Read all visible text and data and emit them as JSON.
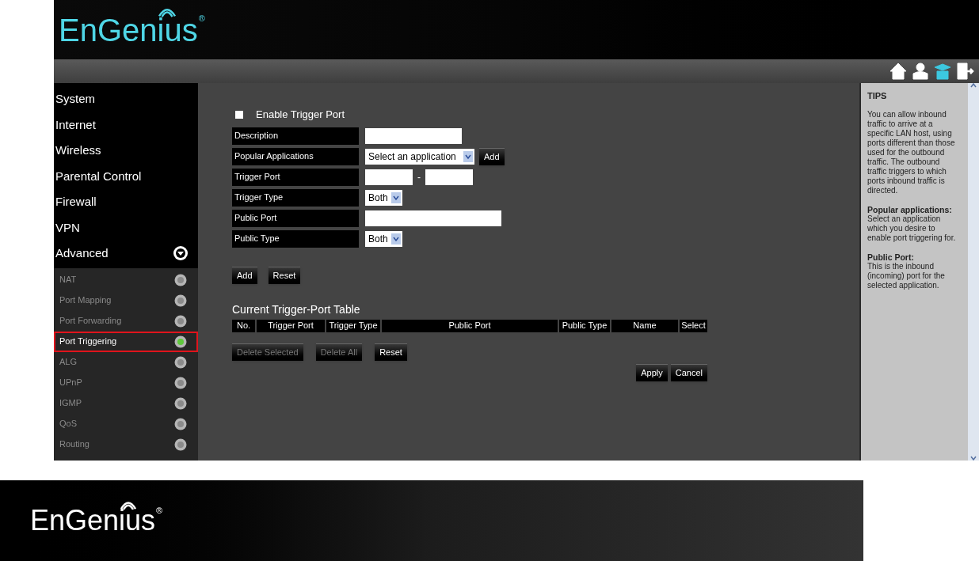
{
  "header": {
    "logo": "EnGenius",
    "logo_mark": "®",
    "icons": [
      {
        "kind": "home",
        "selected": false
      },
      {
        "kind": "user",
        "selected": false
      },
      {
        "kind": "wizard",
        "selected": true
      },
      {
        "kind": "exit",
        "selected": false
      }
    ]
  },
  "sidebar": {
    "items": [
      {
        "label": "System"
      },
      {
        "label": "Internet"
      },
      {
        "label": "Wireless"
      },
      {
        "label": "Parental Control"
      },
      {
        "label": "Firewall"
      },
      {
        "label": "VPN"
      },
      {
        "label": "Advanced",
        "expanded": true,
        "children": [
          {
            "label": "NAT",
            "selected": false
          },
          {
            "label": "Port Mapping",
            "selected": false
          },
          {
            "label": "Port Forwarding",
            "selected": false
          },
          {
            "label": "Port Triggering",
            "selected": true
          },
          {
            "label": "ALG",
            "selected": false
          },
          {
            "label": "UPnP",
            "selected": false
          },
          {
            "label": "IGMP",
            "selected": false
          },
          {
            "label": "QoS",
            "selected": false
          },
          {
            "label": "Routing",
            "selected": false
          }
        ]
      }
    ]
  },
  "form": {
    "enable": {
      "label": "Enable Trigger Port",
      "checked": false
    },
    "rows": [
      {
        "label": "Description",
        "kind": "text"
      },
      {
        "label": "Popular Applications",
        "kind": "select_add",
        "value": "Select an application",
        "button": "Add"
      },
      {
        "label": "Trigger Port",
        "kind": "range",
        "separator": "-"
      },
      {
        "label": "Trigger Type",
        "kind": "select",
        "value": "Both"
      },
      {
        "label": "Public Port",
        "kind": "wide_text"
      },
      {
        "label": "Public Type",
        "kind": "select",
        "value": "Both"
      }
    ],
    "buttons": [
      "Add",
      "Reset"
    ]
  },
  "table": {
    "title": "Current Trigger-Port Table",
    "columns": [
      "No.",
      "Trigger Port",
      "Trigger Type",
      "Public Port",
      "Public Type",
      "Name",
      "Select"
    ],
    "buttons": [
      {
        "label": "Delete Selected",
        "disabled": true
      },
      {
        "label": "Delete All",
        "disabled": true
      },
      {
        "label": "Reset",
        "disabled": false
      }
    ]
  },
  "actions": [
    "Apply",
    "Cancel"
  ],
  "tips": {
    "title": "TIPS",
    "sections": [
      {
        "body": "You can allow inbound traffic to arrive at a specific LAN host, using ports different than those used for the outbound traffic. The outbound traffic triggers to which ports inbound traffic is directed."
      },
      {
        "heading": "Popular applications:",
        "body": "Select an application which you desire to enable port triggering for."
      },
      {
        "heading": "Public Port:",
        "body": "This is the inbound (incoming) port for the selected application."
      }
    ]
  },
  "footer": {
    "logo": "EnGenius",
    "logo_mark": "®"
  }
}
